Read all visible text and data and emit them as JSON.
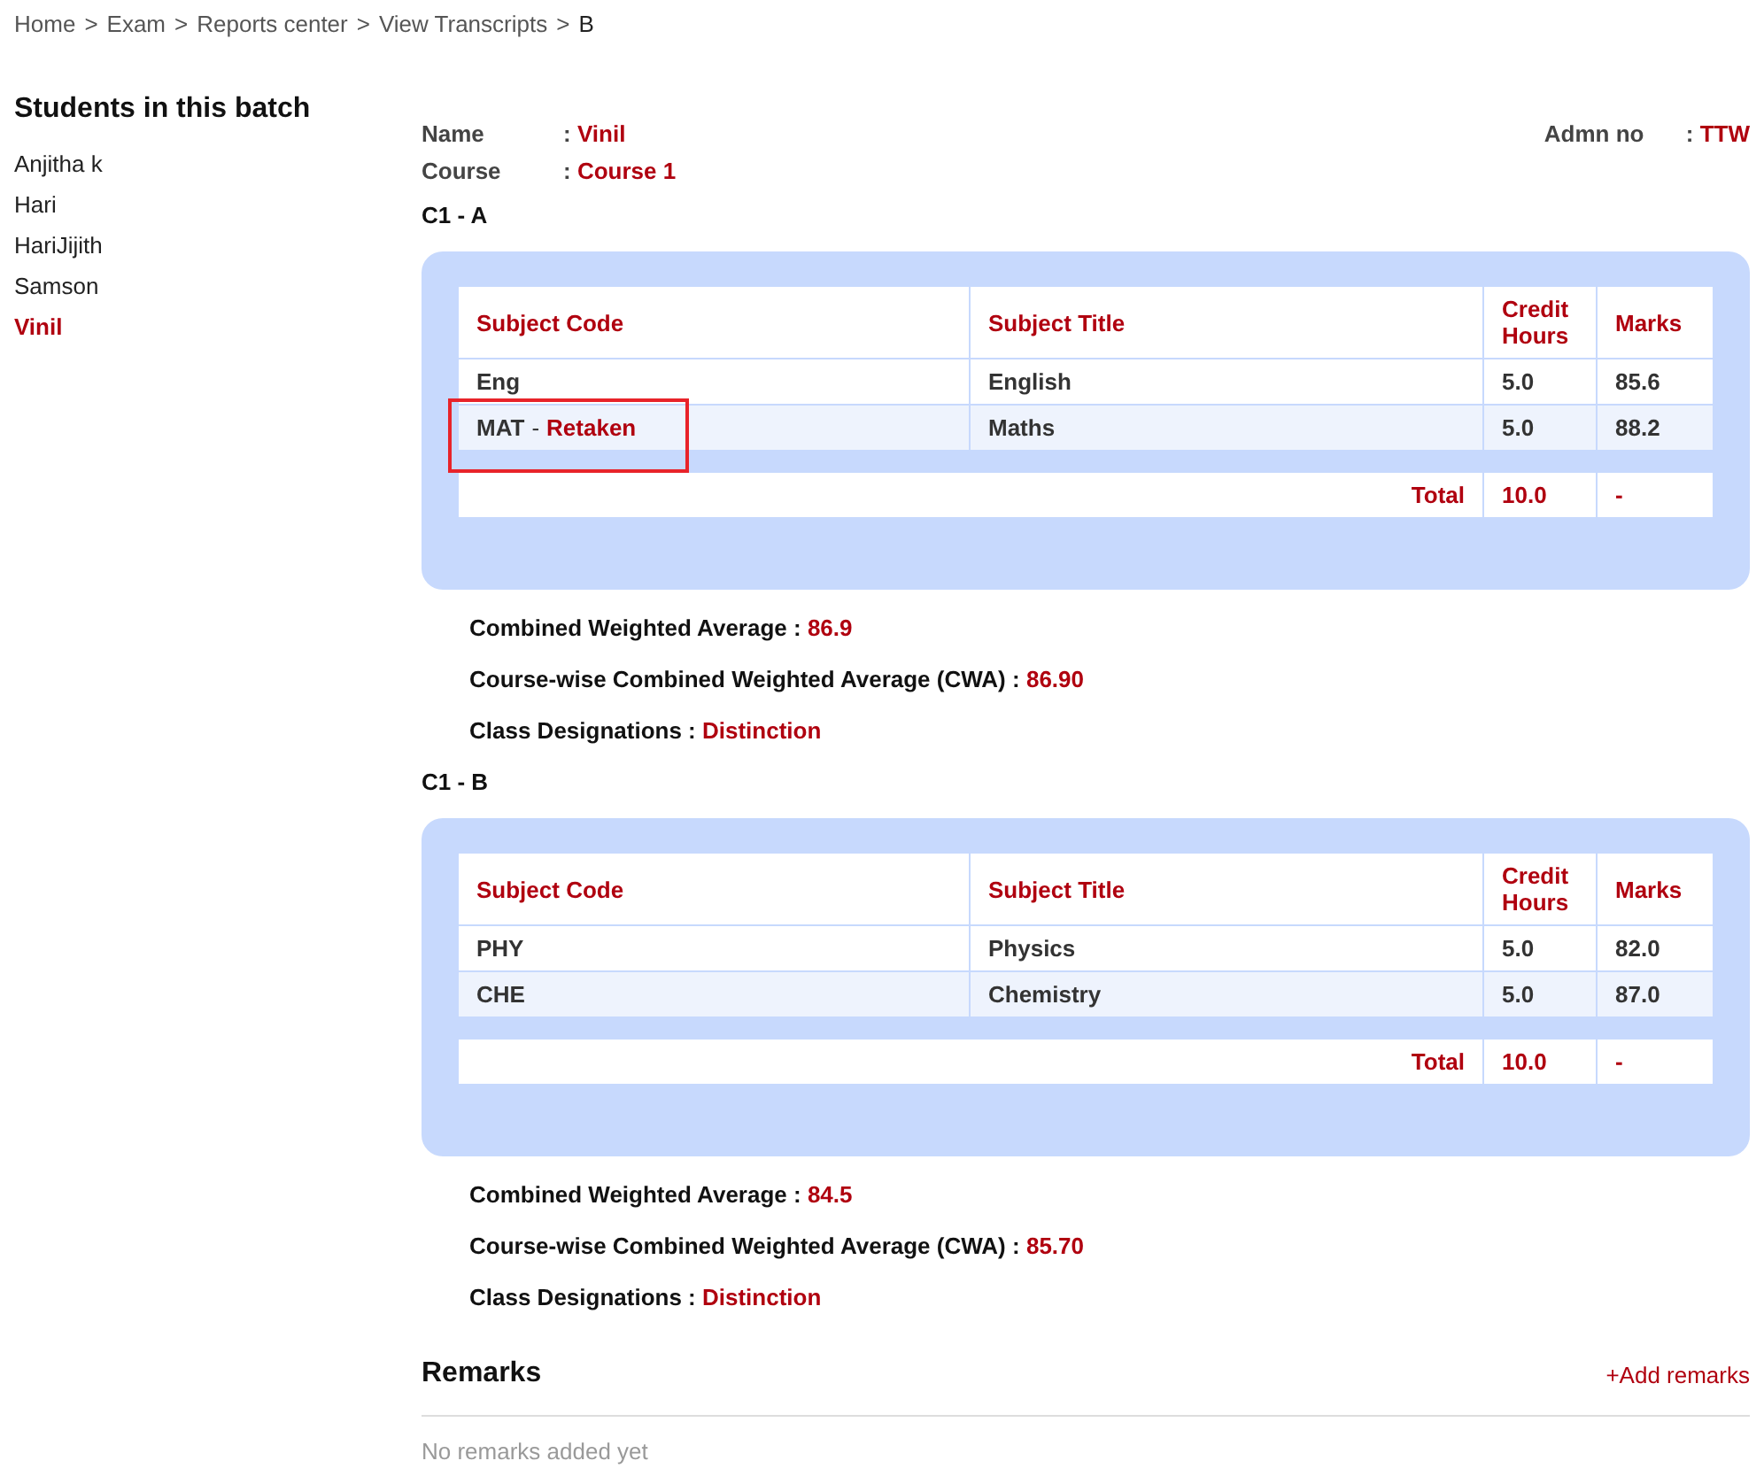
{
  "breadcrumb": [
    "Home",
    "Exam",
    "Reports center",
    "View Transcripts",
    "B"
  ],
  "breadcrumb_separator": ">",
  "field_colon": ":",
  "note_separator": "-",
  "sidebar": {
    "title": "Students in this batch",
    "items": [
      {
        "label": "Anjitha k",
        "selected": false
      },
      {
        "label": "Hari",
        "selected": false
      },
      {
        "label": "HariJijith",
        "selected": false
      },
      {
        "label": "Samson",
        "selected": false
      },
      {
        "label": "Vinil",
        "selected": true
      }
    ]
  },
  "student": {
    "name_label": "Name",
    "name": "Vinil",
    "course_label": "Course",
    "course": "Course 1",
    "admn_label": "Admn no",
    "admn": "TTW"
  },
  "batches": [
    {
      "title": "C1 - A",
      "columns": [
        "Subject Code",
        "Subject Title",
        "Credit Hours",
        "Marks"
      ],
      "rows": [
        {
          "code": "Eng",
          "note": null,
          "highlighted": false,
          "title": "English",
          "credit": "5.0",
          "marks": "85.6"
        },
        {
          "code": "MAT",
          "note": "Retaken",
          "highlighted": true,
          "title": "Maths",
          "credit": "5.0",
          "marks": "88.2"
        }
      ],
      "total": {
        "label": "Total",
        "credit": "10.0",
        "marks": "-"
      },
      "summary": [
        {
          "label": "Combined Weighted Average :",
          "value": "86.9"
        },
        {
          "label": "Course-wise Combined Weighted Average (CWA) :",
          "value": "86.90"
        },
        {
          "label": "Class Designations :",
          "value": "Distinction"
        }
      ]
    },
    {
      "title": "C1 - B",
      "columns": [
        "Subject Code",
        "Subject Title",
        "Credit Hours",
        "Marks"
      ],
      "rows": [
        {
          "code": "PHY",
          "note": null,
          "highlighted": false,
          "title": "Physics",
          "credit": "5.0",
          "marks": "82.0"
        },
        {
          "code": "CHE",
          "note": null,
          "highlighted": false,
          "title": "Chemistry",
          "credit": "5.0",
          "marks": "87.0"
        }
      ],
      "total": {
        "label": "Total",
        "credit": "10.0",
        "marks": "-"
      },
      "summary": [
        {
          "label": "Combined Weighted Average :",
          "value": "84.5"
        },
        {
          "label": "Course-wise Combined Weighted Average (CWA) :",
          "value": "85.70"
        },
        {
          "label": "Class Designations :",
          "value": "Distinction"
        }
      ]
    }
  ],
  "remarks": {
    "title": "Remarks",
    "add_link": "+Add remarks",
    "empty": "No remarks added yet"
  }
}
